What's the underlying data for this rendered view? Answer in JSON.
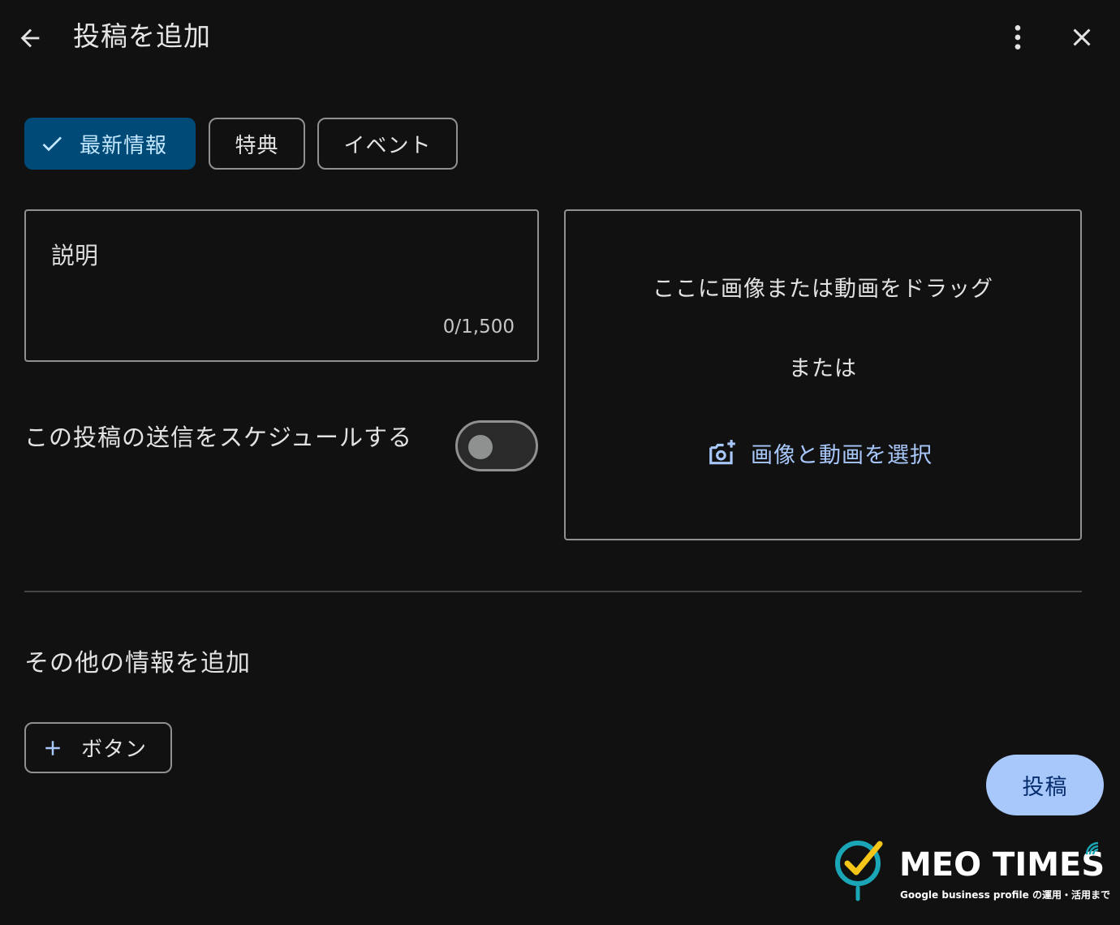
{
  "header": {
    "title": "投稿を追加"
  },
  "chips": {
    "latest": "最新情報",
    "benefit": "特典",
    "event": "イベント"
  },
  "description": {
    "label": "説明",
    "counter": "0/1,500"
  },
  "schedule": {
    "label": "この投稿の送信をスケジュールする",
    "enabled": false
  },
  "upload": {
    "drag_text": "ここに画像または動画をドラッグ",
    "or_text": "または",
    "select_label": "画像と動画を選択"
  },
  "more_info": {
    "heading": "その他の情報を追加",
    "button_label": "ボタン"
  },
  "actions": {
    "post_label": "投稿"
  },
  "watermark": {
    "brand": "MEO TIMES",
    "tagline": "Google business profile の運用・活用まで"
  },
  "colors": {
    "background": "#111111",
    "chip_selected_bg": "#004a77",
    "chip_selected_text": "#c2e7ff",
    "outline": "#8e918f",
    "link": "#a8c7fa",
    "post_bg": "#a8c7fa",
    "post_text": "#062e6f",
    "logo_teal": "#1aa6b7",
    "logo_yellow": "#f5c518"
  },
  "icons": {
    "back": "arrow-left-icon",
    "more": "more-vert-icon",
    "close": "close-icon",
    "check": "check-icon",
    "add_photo": "add-photo-icon",
    "plus": "plus-icon"
  }
}
